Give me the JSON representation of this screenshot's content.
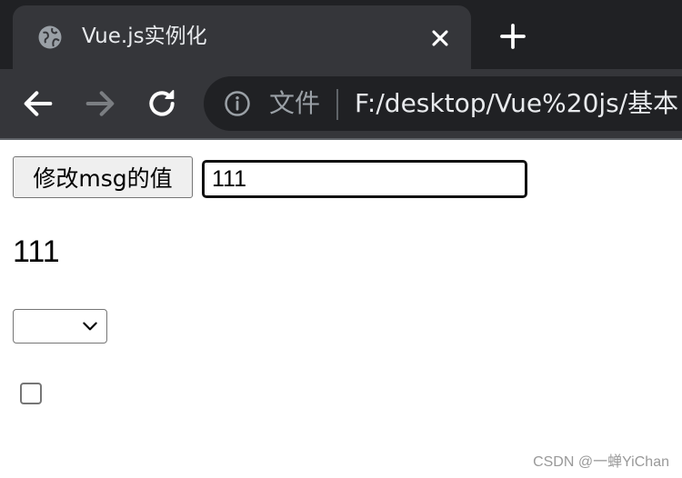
{
  "tab": {
    "title": "Vue.js实例化",
    "favicon_icon": "globe-icon",
    "close_icon": "close-icon"
  },
  "tabstrip": {
    "new_tab_icon": "plus-icon"
  },
  "toolbar": {
    "back_icon": "arrow-left-icon",
    "forward_icon": "arrow-right-icon",
    "reload_icon": "reload-icon",
    "info_icon": "info-icon",
    "security_label": "文件",
    "url": "F:/desktop/Vue%20js/基本"
  },
  "page": {
    "button_label": "修改msg的值",
    "input_value": "111",
    "msg_text": "111",
    "select_value": "",
    "checkbox_checked": false
  },
  "watermark": "CSDN @一蝉YiChan",
  "colors": {
    "tabstrip_bg": "#202124",
    "toolbar_bg": "#35363a",
    "omnibox_bg": "#202124",
    "tab_text": "#e8eaed",
    "muted_icon": "#9aa0a6"
  }
}
